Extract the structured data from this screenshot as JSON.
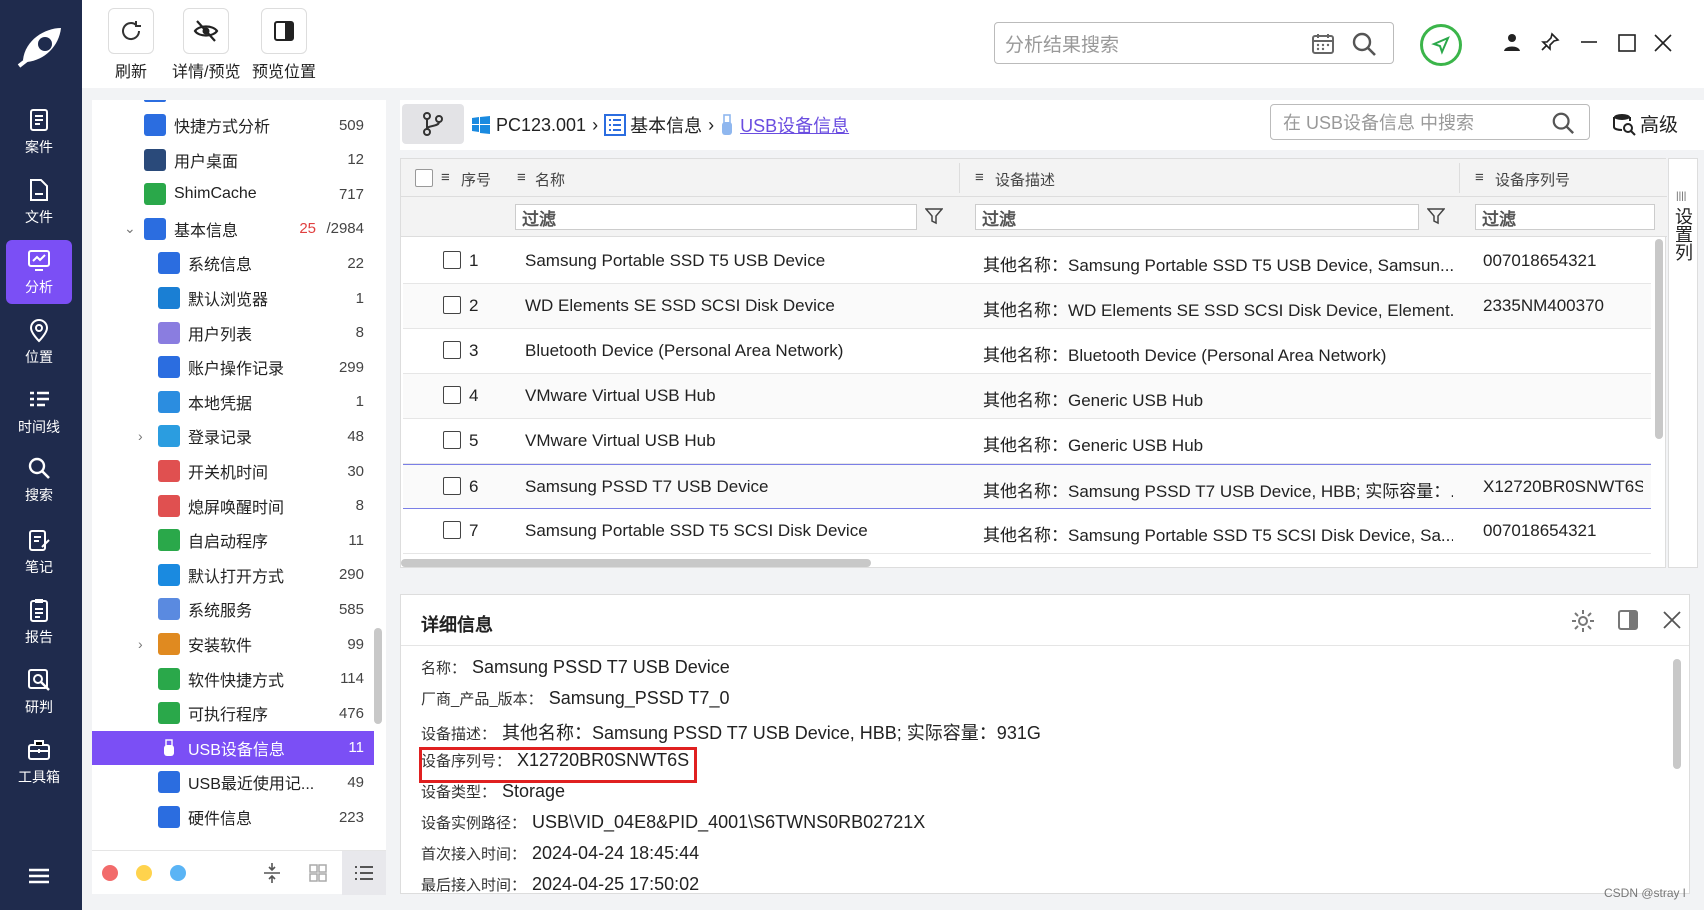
{
  "toolbar": {
    "refresh": "刷新",
    "detail_preview": "详情/预览",
    "preview_pos": "预览位置"
  },
  "search": {
    "placeholder": "分析结果搜索"
  },
  "rail": [
    {
      "label": "案件",
      "icon": "case-icon"
    },
    {
      "label": "文件",
      "icon": "file-icon"
    },
    {
      "label": "分析",
      "icon": "analysis-icon"
    },
    {
      "label": "位置",
      "icon": "location-icon"
    },
    {
      "label": "时间线",
      "icon": "timeline-icon"
    },
    {
      "label": "搜索",
      "icon": "search-icon"
    },
    {
      "label": "笔记",
      "icon": "note-icon"
    },
    {
      "label": "报告",
      "icon": "report-icon"
    },
    {
      "label": "研判",
      "icon": "judge-icon"
    },
    {
      "label": "工具箱",
      "icon": "toolbox-icon"
    }
  ],
  "tree": [
    {
      "label": "快捷方式分析",
      "count": "509",
      "color": "#2b6de0"
    },
    {
      "label": "用户桌面",
      "count": "12",
      "color": "#2a4a7a"
    },
    {
      "label": "ShimCache",
      "count": "717",
      "color": "#2aa84a"
    },
    {
      "label": "基本信息",
      "count_red": "25",
      "count": "/2984",
      "color": "#2b6de0"
    },
    {
      "label": "系统信息",
      "count": "22",
      "color": "#2b6de0"
    },
    {
      "label": "默认浏览器",
      "count": "1",
      "color": "#1a7fd4"
    },
    {
      "label": "用户列表",
      "count": "8",
      "color": "#8a7de0"
    },
    {
      "label": "账户操作记录",
      "count": "299",
      "color": "#2b6de0"
    },
    {
      "label": "本地凭据",
      "count": "1",
      "color": "#2b8de0"
    },
    {
      "label": "登录记录",
      "count": "48",
      "color": "#2b9de0"
    },
    {
      "label": "开关机时间",
      "count": "30",
      "color": "#e05050"
    },
    {
      "label": "熄屏唤醒时间",
      "count": "8",
      "color": "#e05050"
    },
    {
      "label": "自启动程序",
      "count": "11",
      "color": "#2aa84a"
    },
    {
      "label": "默认打开方式",
      "count": "290",
      "color": "#1a8ae0"
    },
    {
      "label": "系统服务",
      "count": "585",
      "color": "#5a8ae0"
    },
    {
      "label": "安装软件",
      "count": "99",
      "color": "#e08a20"
    },
    {
      "label": "软件快捷方式",
      "count": "114",
      "color": "#2aa84a"
    },
    {
      "label": "可执行程序",
      "count": "476",
      "color": "#2aa84a"
    },
    {
      "label": "USB设备信息",
      "count": "11",
      "color": "#ffffff"
    },
    {
      "label": "USB最近使用记...",
      "count": "49",
      "color": "#2b6de0"
    },
    {
      "label": "硬件信息",
      "count": "223",
      "color": "#2b6de0"
    }
  ],
  "crumb": {
    "pc": "PC123.001",
    "basic": "基本信息",
    "usb": "USB设备信息",
    "search_placeholder": "在 USB设备信息 中搜索",
    "advanced": "高级"
  },
  "grid": {
    "headers": {
      "index": "序号",
      "name": "名称",
      "desc": "设备描述",
      "serial": "设备序列号"
    },
    "filter": "过滤",
    "side": "设置列",
    "rows": [
      {
        "i": "1",
        "name": "Samsung Portable SSD T5 USB Device",
        "desc": "其他名称：Samsung Portable SSD T5 USB Device, Samsun...",
        "serial": "007018654321"
      },
      {
        "i": "2",
        "name": "WD Elements SE SSD SCSI Disk Device",
        "desc": "其他名称：WD Elements SE SSD SCSI Disk Device, Element...",
        "serial": "2335NM400370"
      },
      {
        "i": "3",
        "name": "Bluetooth Device (Personal Area Network)",
        "desc": "其他名称：Bluetooth Device (Personal Area Network)",
        "serial": ""
      },
      {
        "i": "4",
        "name": "VMware Virtual USB Hub",
        "desc": "其他名称：Generic USB Hub",
        "serial": ""
      },
      {
        "i": "5",
        "name": "VMware Virtual USB Hub",
        "desc": "其他名称：Generic USB Hub",
        "serial": ""
      },
      {
        "i": "6",
        "name": "Samsung PSSD T7 USB Device",
        "desc": "其他名称：Samsung PSSD T7 USB Device, HBB; 实际容量：...",
        "serial": "X12720BR0SNWT6S"
      },
      {
        "i": "7",
        "name": "Samsung Portable SSD T5 SCSI Disk Device",
        "desc": "其他名称：Samsung Portable SSD T5 SCSI Disk Device, Sa...",
        "serial": "007018654321"
      }
    ]
  },
  "detail": {
    "title": "详细信息",
    "lines": [
      {
        "k": "名称：",
        "v": "Samsung PSSD T7 USB Device"
      },
      {
        "k": "厂商_产品_版本：",
        "v": "Samsung_PSSD T7_0"
      },
      {
        "k": "设备描述：",
        "v": "其他名称：Samsung PSSD T7 USB Device, HBB; 实际容量：931G"
      },
      {
        "k": "设备序列号：",
        "v": "X12720BR0SNWT6S"
      },
      {
        "k": "设备类型：",
        "v": "Storage"
      },
      {
        "k": "设备实例路径：",
        "v": "USB\\VID_04E8&PID_4001\\S6TWNS0RB02721X"
      },
      {
        "k": "首次接入时间：",
        "v": "2024-04-24 18:45:44"
      },
      {
        "k": "最后接入时间：",
        "v": "2024-04-25 17:50:02"
      }
    ]
  },
  "watermark": "CSDN @stray l"
}
